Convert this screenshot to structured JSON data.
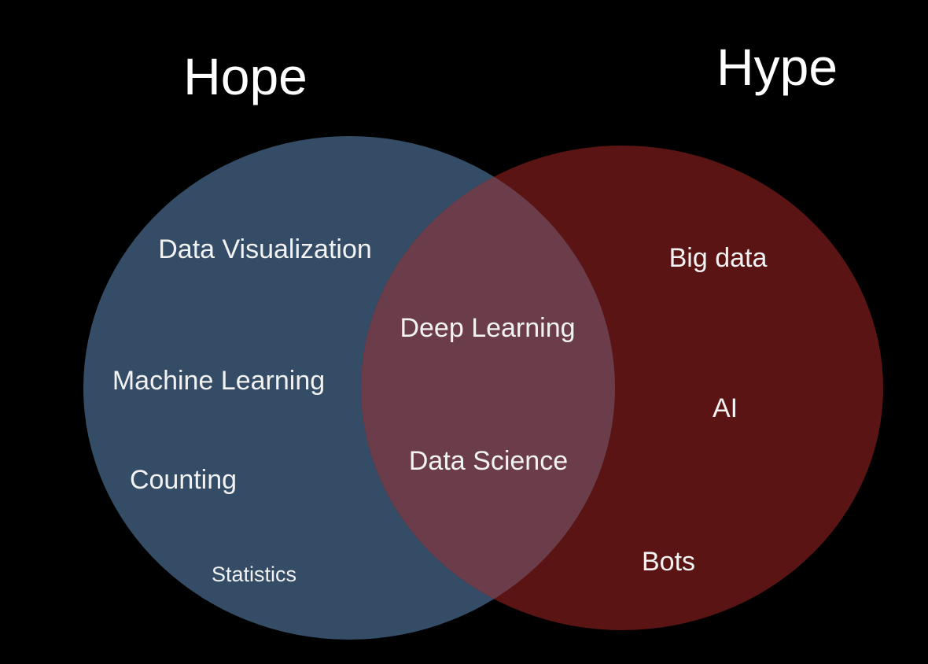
{
  "sets": [
    {
      "name": "Hope",
      "color": "#344c66",
      "items": [
        "Data Visualization",
        "Machine Learning",
        "Counting",
        "Statistics"
      ]
    },
    {
      "name": "Hype",
      "color": "#5a1414",
      "items": [
        "Big data",
        "AI",
        "Bots"
      ]
    }
  ],
  "intersection": {
    "color": "#6b3d4b",
    "items": [
      "Deep Learning",
      "Data Science"
    ]
  }
}
